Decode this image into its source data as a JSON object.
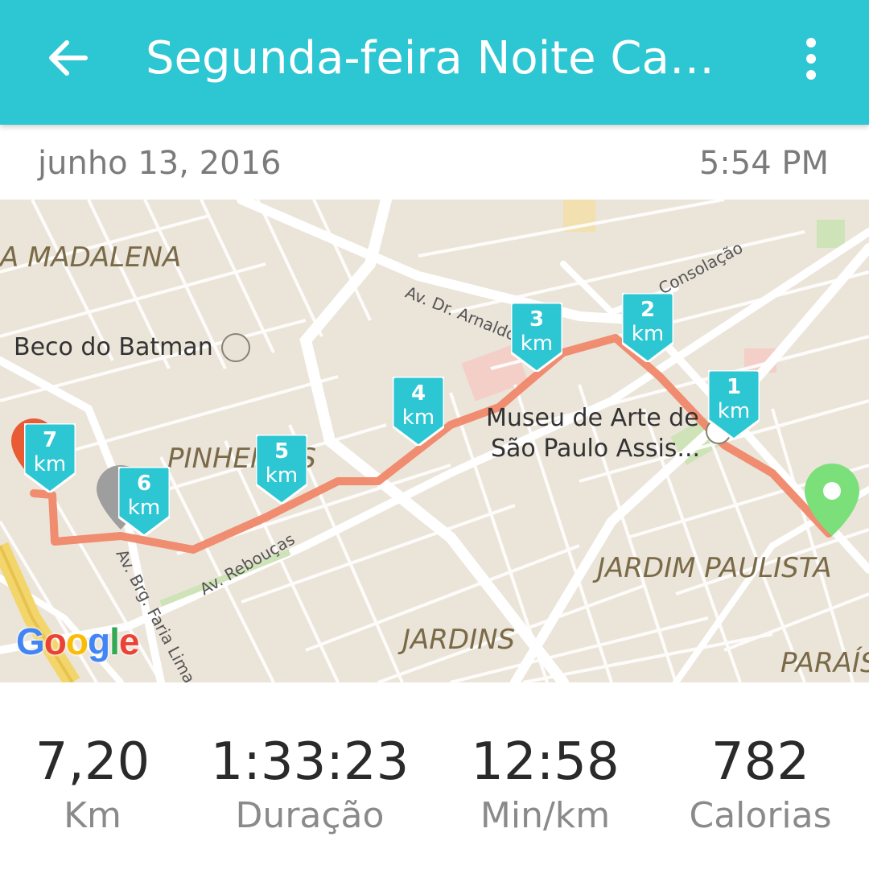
{
  "appbar": {
    "title": "Segunda-feira Noite Caminhada",
    "back_icon": "arrow-left-icon",
    "menu_icon": "more-vertical-icon"
  },
  "activity": {
    "date": "junho 13, 2016",
    "time": "5:54 PM"
  },
  "map": {
    "places": {
      "madalena": "A MADALENA",
      "pinheiros": "PINHEIROS",
      "jardim_paulista": "JARDIM PAULISTA",
      "jardins": "JARDINS",
      "paraiso": "PARAÍS"
    },
    "pois": {
      "beco": "Beco do Batman",
      "masp_line1": "Museu de Arte de",
      "masp_line2": "São Paulo Assis..."
    },
    "streets": {
      "arnaldo": "Av. Dr. Arnaldo",
      "consolacao": "Consolação",
      "reboucas": "Av. Rebouças",
      "faria_lima": "Av. Brg. Faria Lima"
    },
    "km_unit": "km",
    "markers": [
      {
        "label": "1"
      },
      {
        "label": "2"
      },
      {
        "label": "3"
      },
      {
        "label": "4"
      },
      {
        "label": "5"
      },
      {
        "label": "6"
      },
      {
        "label": "7"
      }
    ],
    "logo": "Google",
    "route_color": "#F08466",
    "marker_color": "#2DC6D3",
    "start_pin_color": "#7BE07A"
  },
  "stats": [
    {
      "value": "7,20",
      "label": "Km"
    },
    {
      "value": "1:33:23",
      "label": "Duração"
    },
    {
      "value": "12:58",
      "label": "Min/km"
    },
    {
      "value": "782",
      "label": "Calorias"
    }
  ]
}
